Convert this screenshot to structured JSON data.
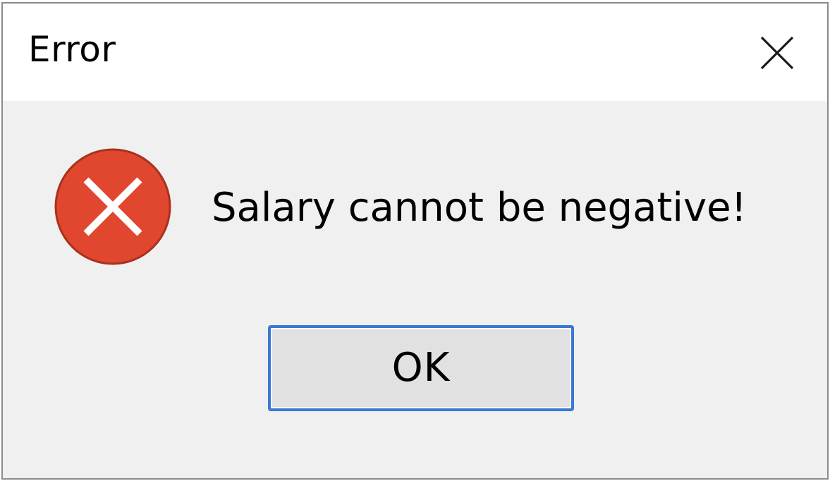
{
  "dialog": {
    "title": "Error",
    "message": "Salary cannot be negative!",
    "ok_label": "OK",
    "icons": {
      "close": "close-icon",
      "status": "error-icon"
    },
    "colors": {
      "error_fill": "#e0472e",
      "error_border": "#a8321d",
      "button_border": "#3a78d4",
      "button_fill": "#e1e1e1",
      "content_bg": "#f0f0f0",
      "titlebar_bg": "#ffffff"
    }
  }
}
